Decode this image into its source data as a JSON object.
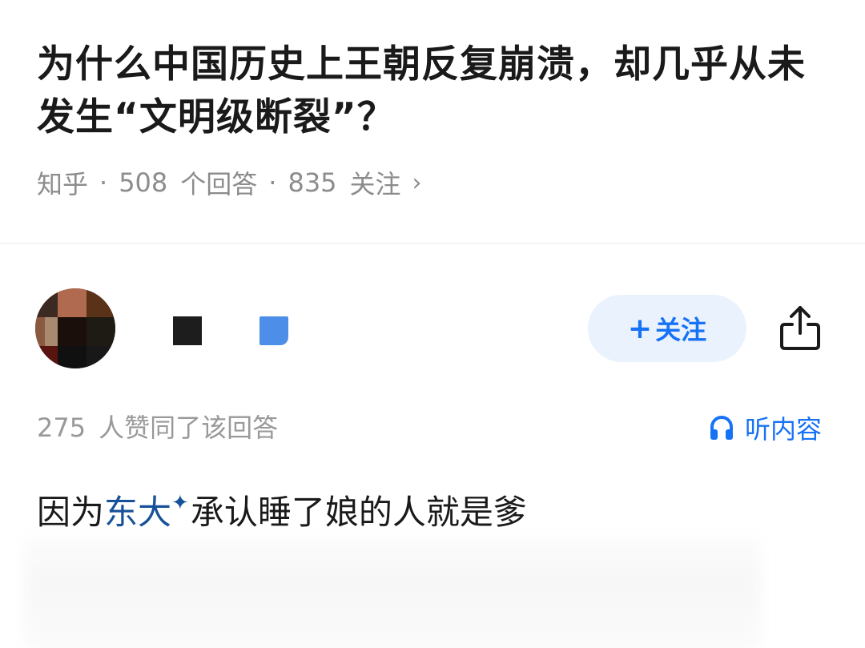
{
  "question": {
    "title": "为什么中国历史上王朝反复崩溃，却几乎从未发生“文明级断裂”？",
    "source": "知乎",
    "answer_count": "508",
    "answer_unit": "个回答",
    "follow_count": "835",
    "follow_unit": "关注",
    "separator": "·",
    "chevron": "›"
  },
  "author": {
    "avatar_icon": "avatar-pixelated",
    "follow_button": {
      "plus": "+",
      "label": "关注"
    },
    "share_icon": "share-icon"
  },
  "answer": {
    "upvote_count": "275",
    "upvote_text": "人赞同了该回答",
    "listen_label": "听内容",
    "listen_icon": "headphones-icon",
    "text_before": "因为",
    "link_text": "东大",
    "link_mark": "✦",
    "text_after": "承认睡了娘的人就是爹"
  },
  "colors": {
    "accent": "#1772f6",
    "link": "#175199",
    "follow_bg": "#eaf2fd",
    "text_primary": "#1a1a1a",
    "text_secondary": "#8c8c8c"
  }
}
